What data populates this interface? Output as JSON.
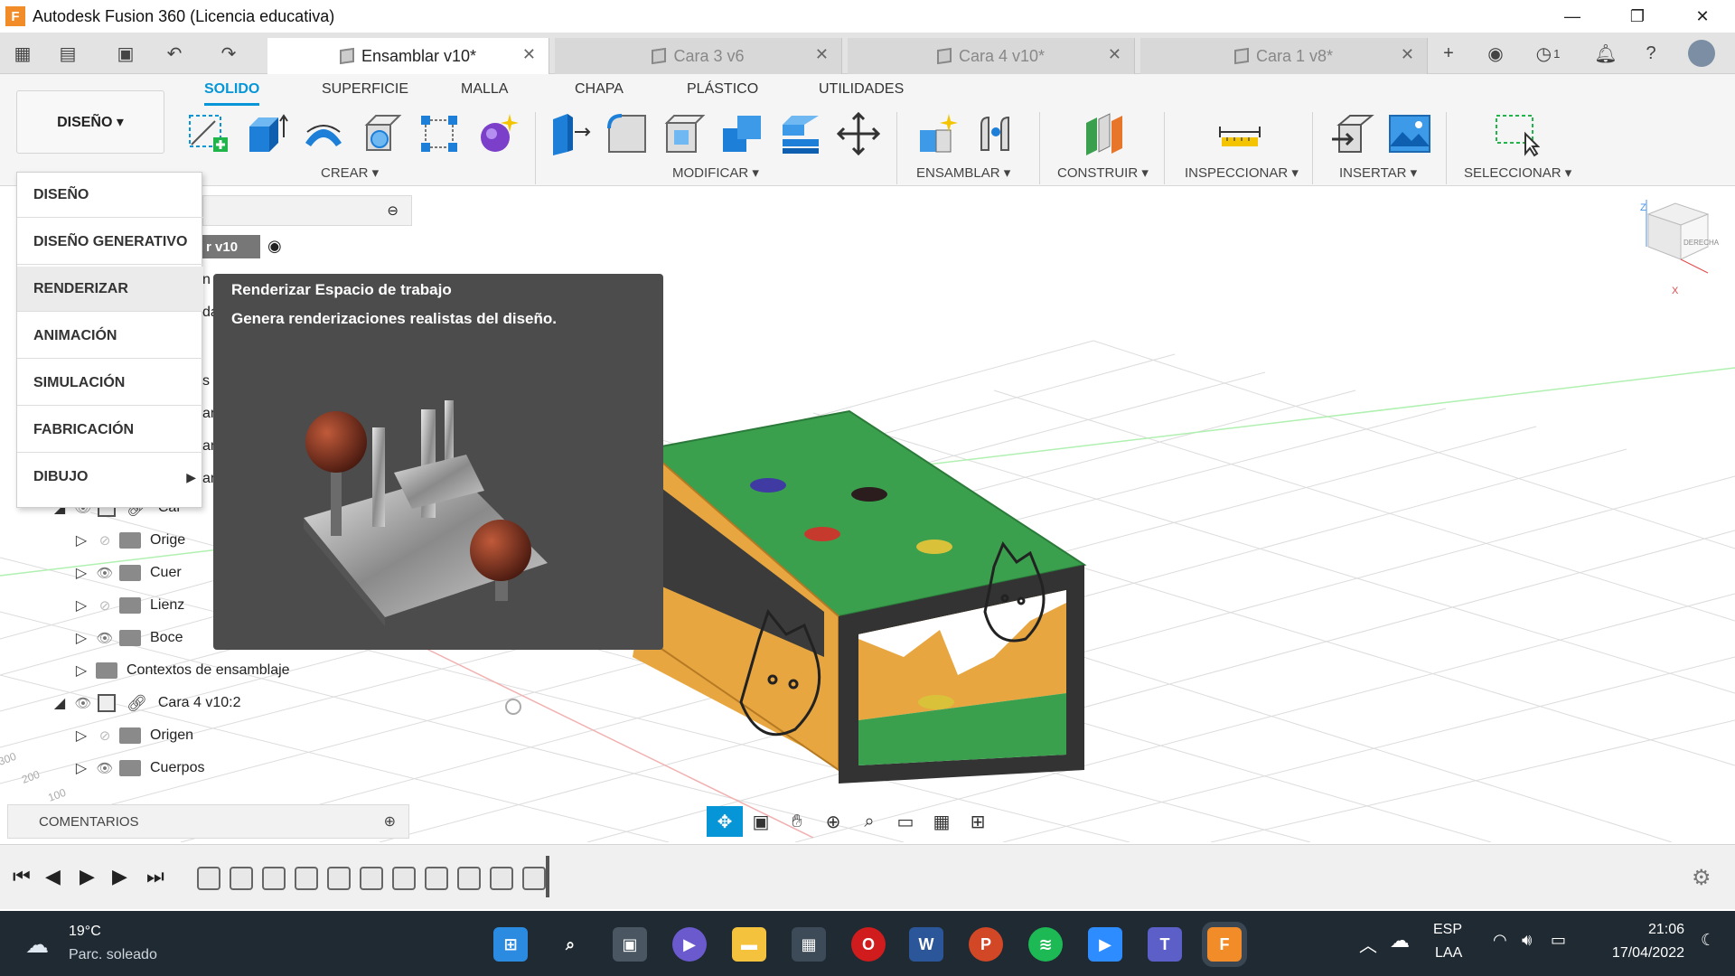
{
  "titlebar": {
    "title": "Autodesk Fusion 360 (Licencia educativa)",
    "logo_letter": "F",
    "minimize": "—",
    "restore": "❐",
    "close": "✕"
  },
  "tabs": [
    {
      "label": "Ensamblar v10*",
      "active": true
    },
    {
      "label": "Cara 3 v6",
      "active": false
    },
    {
      "label": "Cara 4 v10*",
      "active": false
    },
    {
      "label": "Cara 1 v8*",
      "active": false
    }
  ],
  "tabbar": {
    "jobs_count": "1"
  },
  "ribbon": {
    "workspace_label": "DISEÑO ▾",
    "tabs": [
      "SOLIDO",
      "SUPERFICIE",
      "MALLA",
      "CHAPA",
      "PLÁSTICO",
      "UTILIDADES"
    ],
    "groups": [
      "CREAR ▾",
      "MODIFICAR ▾",
      "ENSAMBLAR ▾",
      "CONSTRUIR ▾",
      "INSPECCIONAR ▾",
      "INSERTAR ▾",
      "SELECCIONAR ▾"
    ]
  },
  "workspace_menu": {
    "items": [
      "DISEÑO",
      "DISEÑO GENERATIVO",
      "RENDERIZAR",
      "ANIMACIÓN",
      "SIMULACIÓN",
      "FABRICACIÓN",
      "DIBUJO"
    ],
    "hover_index": 2
  },
  "tooltip": {
    "title": "Renderizar Espacio de trabajo",
    "description": "Genera renderizaciones realistas del diseño."
  },
  "browser": {
    "root_fragment": "r v10",
    "partial_rows": [
      "n",
      "da",
      "s",
      "an",
      "an",
      "an"
    ],
    "rows": [
      {
        "label": "Car",
        "type": "component"
      },
      {
        "label": "Orige",
        "type": "folder",
        "visible": false
      },
      {
        "label": "Cuer",
        "type": "folder",
        "visible": true
      },
      {
        "label": "Lienz",
        "type": "folder",
        "visible": false
      },
      {
        "label": "Boce",
        "type": "folder",
        "visible": true
      },
      {
        "label": "Contextos de ensamblaje",
        "type": "folder"
      },
      {
        "label": "Cara 4 v10:2",
        "type": "component"
      },
      {
        "label": "Origen",
        "type": "folder",
        "visible": false
      },
      {
        "label": "Cuerpos",
        "type": "folder",
        "visible": true
      }
    ]
  },
  "comments": {
    "label": "COMENTARIOS"
  },
  "viewcube": {
    "face": "DERECHA",
    "axis_z": "Z",
    "axis_x": "X"
  },
  "taskbar": {
    "weather_temp": "19°C",
    "weather_desc": "Parc. soleado",
    "lang_top": "ESP",
    "lang_bottom": "LAA",
    "time": "21:06",
    "date": "17/04/2022"
  },
  "colors": {
    "accent": "#0696d7",
    "box_green": "#3aa04e",
    "box_orange": "#e8a640",
    "frame_dark": "#3a3a3a",
    "taskbar": "#1f2a33"
  }
}
